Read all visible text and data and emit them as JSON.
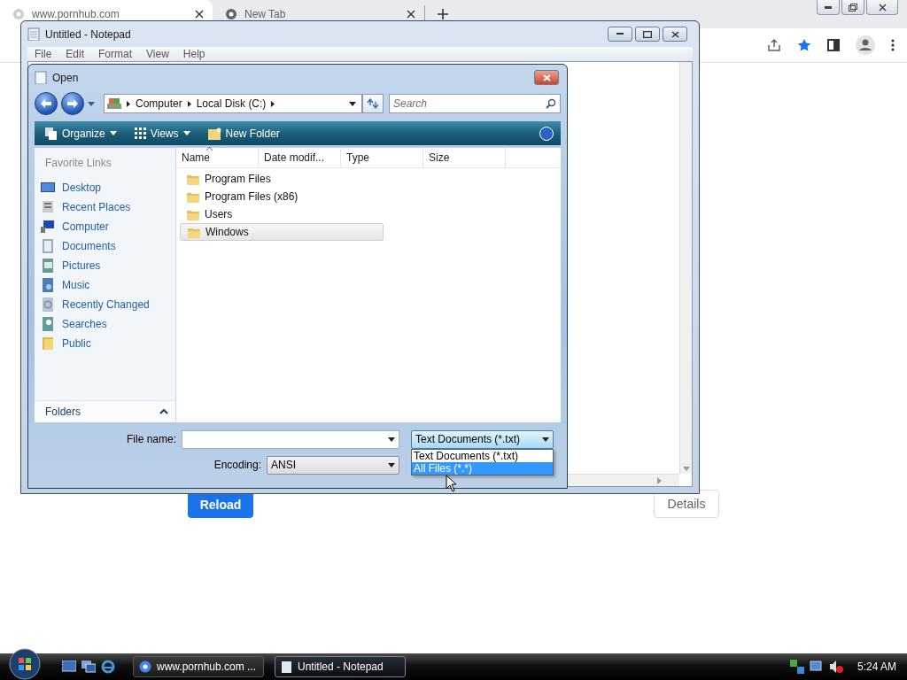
{
  "browser": {
    "tabs": [
      {
        "title": "www.pornhub.com",
        "selected": true
      },
      {
        "title": "New Tab",
        "selected": false
      }
    ],
    "page": {
      "buttons": [
        {
          "label": "Reload",
          "kind": "primary"
        },
        {
          "label": "Details",
          "kind": "secondary"
        }
      ]
    }
  },
  "notepad": {
    "title": "Untitled - Notepad",
    "menu": [
      "File",
      "Edit",
      "Format",
      "View",
      "Help"
    ]
  },
  "open_dialog": {
    "title": "Open",
    "breadcrumb": [
      "Computer",
      "Local Disk (C:)"
    ],
    "search": {
      "placeholder": "Search"
    },
    "toolbar": [
      {
        "label": "Organize",
        "kind": "menu"
      },
      {
        "label": "Views",
        "kind": "menu"
      },
      {
        "label": "New Folder",
        "kind": "action"
      }
    ],
    "favorite_links": {
      "heading": "Favorite Links",
      "items": [
        "Desktop",
        "Recent Places",
        "Computer",
        "Documents",
        "Pictures",
        "Music",
        "Recently Changed",
        "Searches",
        "Public"
      ]
    },
    "folders_label": "Folders",
    "columns": [
      "Name",
      "Date modif...",
      "Type",
      "Size"
    ],
    "files": [
      {
        "name": "Program Files",
        "selected": false
      },
      {
        "name": "Program Files (x86)",
        "selected": false
      },
      {
        "name": "Users",
        "selected": false
      },
      {
        "name": "Windows",
        "selected": true
      }
    ],
    "file_name": {
      "label": "File name:"
    },
    "encoding": {
      "label": "Encoding:",
      "value": "ANSI"
    },
    "file_type": {
      "value": "Text Documents (*.txt)",
      "expanded": true,
      "options": [
        {
          "label": "Text Documents (*.txt)",
          "highlighted": false
        },
        {
          "label": "All Files (*.*)",
          "highlighted": true
        }
      ]
    }
  },
  "taskbar": {
    "tasks": [
      {
        "title": "www.pornhub.com ...",
        "selected": false
      },
      {
        "title": "Untitled - Notepad",
        "selected": true
      }
    ],
    "clock": "5:24 AM"
  }
}
